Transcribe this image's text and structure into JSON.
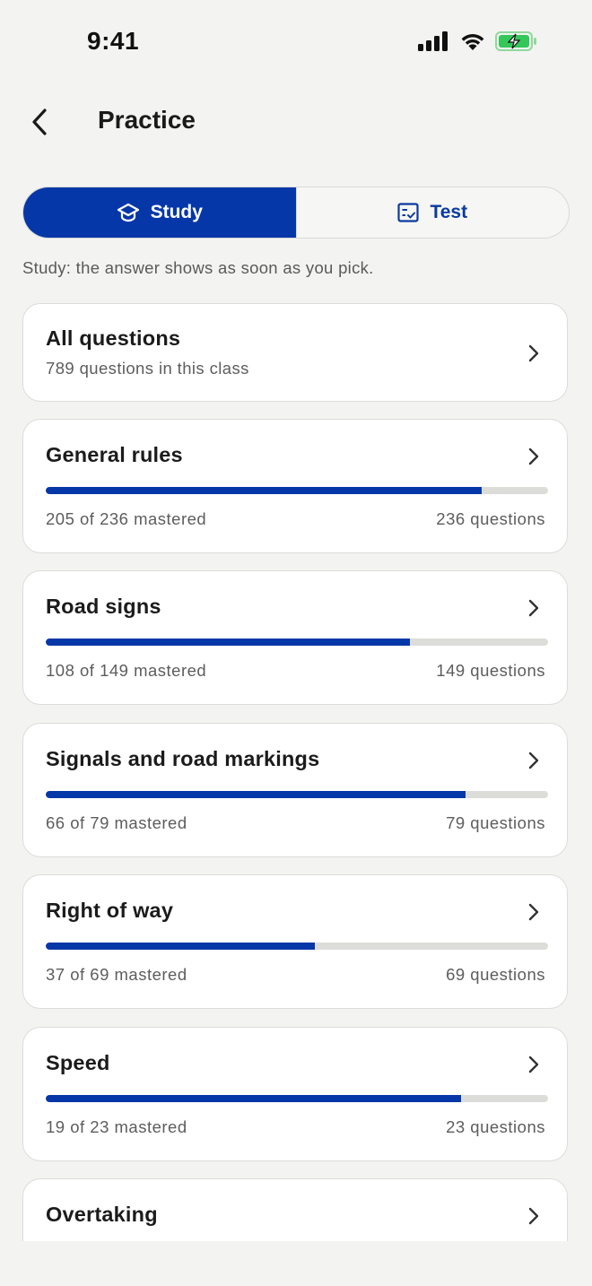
{
  "status_bar": {
    "time": "9:41",
    "icons": [
      "cellular-signal-icon",
      "wifi-icon",
      "battery-charging-icon"
    ]
  },
  "nav": {
    "back_icon": "chevron-left-icon",
    "title": "Practice"
  },
  "mode_toggle": {
    "selected": "Study",
    "options": [
      {
        "label": "Study",
        "icon": "graduation-cap-icon"
      },
      {
        "label": "Test",
        "icon": "checklist-icon"
      }
    ]
  },
  "hint": "Study: the answer shows as soon as you pick.",
  "all_questions": {
    "title": "All questions",
    "subtitle": "789 questions in this class"
  },
  "categories": [
    {
      "title": "General rules",
      "mastered": 205,
      "total": 236,
      "mastered_text": "205 of 236 mastered",
      "count_text": "236 questions"
    },
    {
      "title": "Road signs",
      "mastered": 108,
      "total": 149,
      "mastered_text": "108 of 149 mastered",
      "count_text": "149 questions"
    },
    {
      "title": "Signals and road markings",
      "mastered": 66,
      "total": 79,
      "mastered_text": "66 of 79 mastered",
      "count_text": "79 questions"
    },
    {
      "title": "Right of way",
      "mastered": 37,
      "total": 69,
      "mastered_text": "37 of 69 mastered",
      "count_text": "69 questions"
    },
    {
      "title": "Speed",
      "mastered": 19,
      "total": 23,
      "mastered_text": "19 of 23 mastered",
      "count_text": "23 questions"
    },
    {
      "title": "Overtaking"
    }
  ],
  "colors": {
    "accent": "#0637a8",
    "track": "#dcdcd8",
    "background": "#f3f3f1",
    "battery": "#34c759"
  }
}
